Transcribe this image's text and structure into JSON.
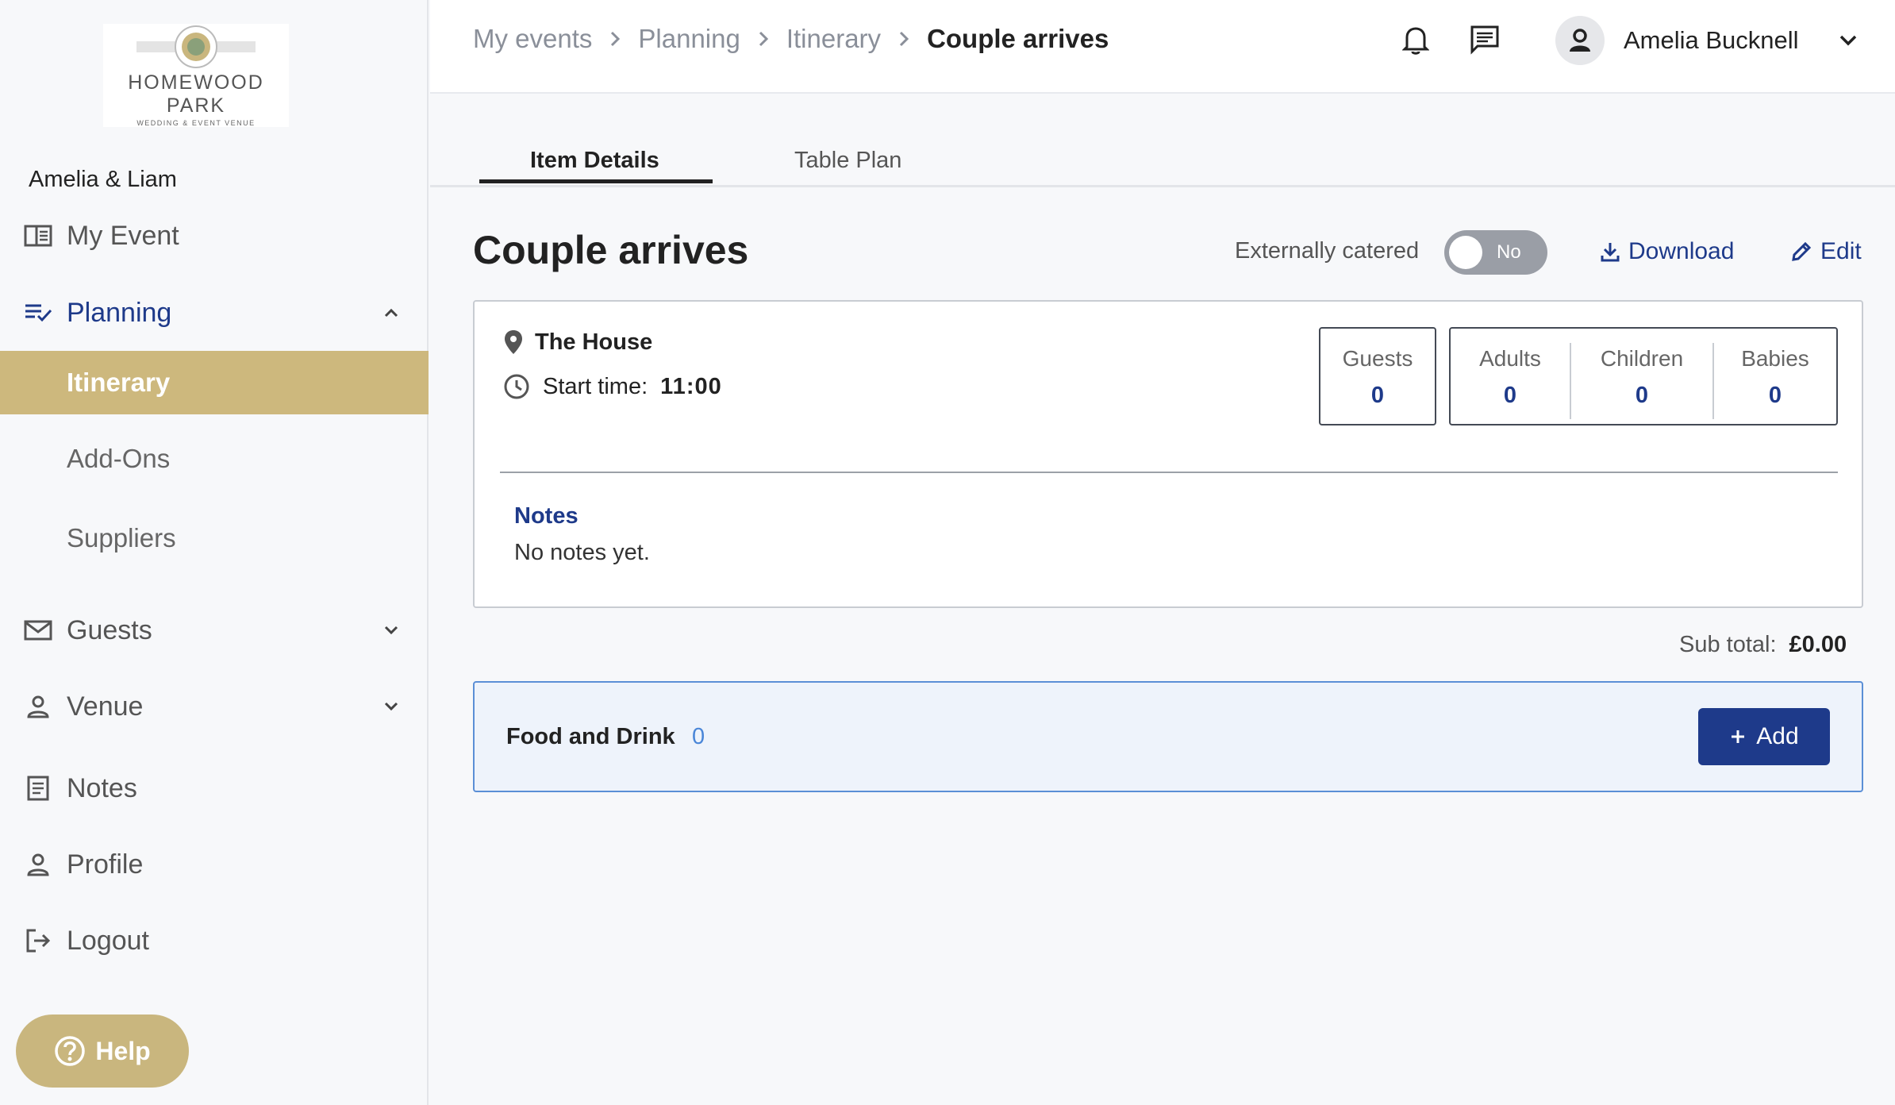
{
  "sidebar": {
    "logo": {
      "line1": "HOMEWOOD",
      "line2": "PARK",
      "tagline": "WEDDING & EVENT VENUE"
    },
    "event_name": "Amelia & Liam",
    "items": [
      {
        "label": "My Event",
        "icon": "book-open-icon"
      },
      {
        "label": "Planning",
        "icon": "checklist-icon"
      },
      {
        "label": "Guests",
        "icon": "mail-icon"
      },
      {
        "label": "Venue",
        "icon": "person-icon"
      },
      {
        "label": "Notes",
        "icon": "document-icon"
      },
      {
        "label": "Profile",
        "icon": "person-icon"
      },
      {
        "label": "Logout",
        "icon": "logout-icon"
      }
    ],
    "planning_sub": [
      {
        "label": "Itinerary",
        "selected": true
      },
      {
        "label": "Add-Ons",
        "selected": false
      },
      {
        "label": "Suppliers",
        "selected": false
      }
    ],
    "help_label": "Help"
  },
  "header": {
    "breadcrumbs": [
      "My events",
      "Planning",
      "Itinerary"
    ],
    "current": "Couple arrives",
    "user_name": "Amelia Bucknell"
  },
  "tabs": [
    {
      "label": "Item Details",
      "active": true
    },
    {
      "label": "Table Plan",
      "active": false
    }
  ],
  "item": {
    "title": "Couple arrives",
    "externally_catered_label": "Externally catered",
    "externally_catered_value": "No",
    "download_label": "Download",
    "edit_label": "Edit",
    "location": "The House",
    "start_time_label": "Start time:",
    "start_time": "11:00",
    "counts": {
      "guests": {
        "label": "Guests",
        "value": "0"
      },
      "adults": {
        "label": "Adults",
        "value": "0"
      },
      "children": {
        "label": "Children",
        "value": "0"
      },
      "babies": {
        "label": "Babies",
        "value": "0"
      }
    },
    "notes_title": "Notes",
    "notes_text": "No notes yet.",
    "subtotal_label": "Sub total:",
    "subtotal_value": "£0.00"
  },
  "food": {
    "label": "Food and Drink",
    "count": "0",
    "add_label": "Add"
  },
  "colors": {
    "accent": "#1e3a8a",
    "gold": "#cdb87d",
    "link_blue": "#4a86d8"
  }
}
